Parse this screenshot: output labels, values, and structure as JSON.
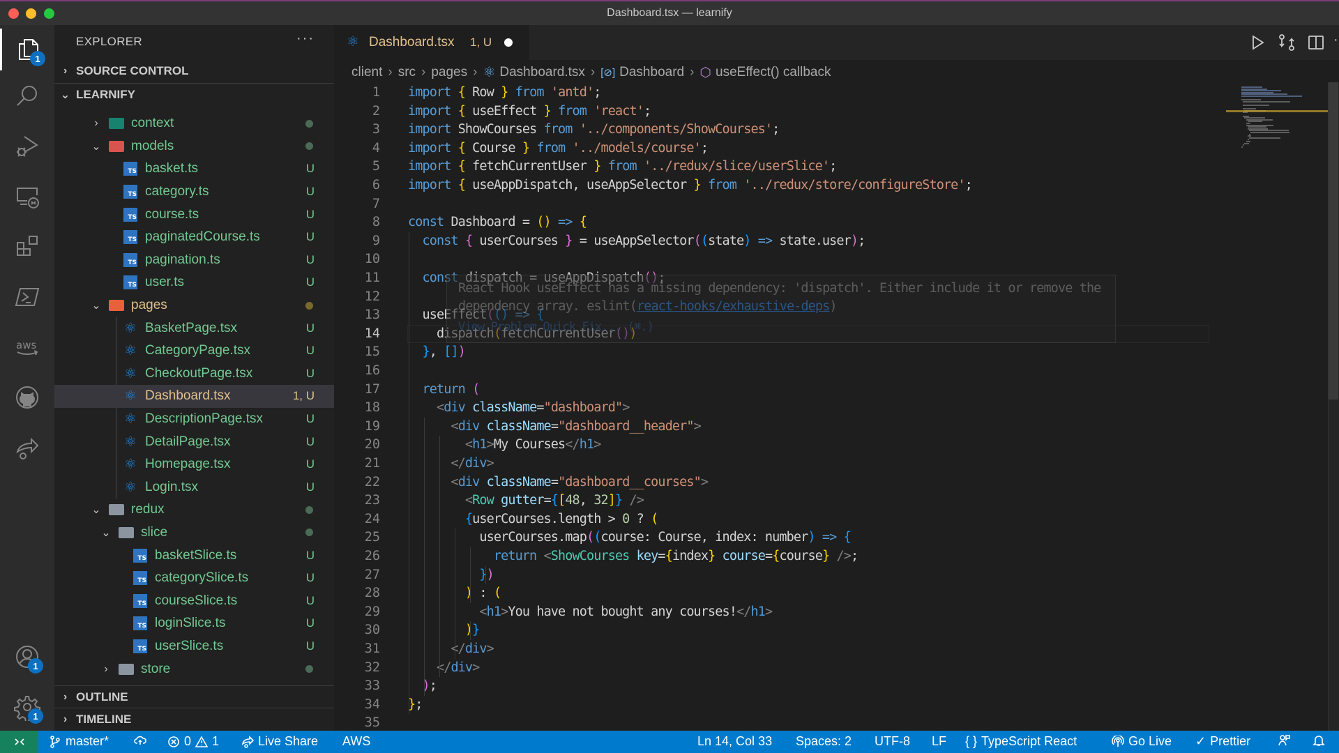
{
  "window": {
    "title": "Dashboard.tsx — learnify"
  },
  "activity_bar": {
    "items": [
      {
        "icon": "explorer-icon",
        "badge": "1",
        "active": true
      },
      {
        "icon": "search-icon"
      },
      {
        "icon": "run-debug-icon"
      },
      {
        "icon": "remote-explorer-icon"
      },
      {
        "icon": "extensions-icon"
      },
      {
        "icon": "powershell-icon"
      },
      {
        "icon": "aws-icon",
        "label": "aws"
      },
      {
        "icon": "github-icon"
      },
      {
        "icon": "live-share-icon"
      }
    ],
    "bottom": [
      {
        "icon": "accounts-icon",
        "badge": "1"
      },
      {
        "icon": "settings-gear-icon",
        "badge": "1"
      }
    ]
  },
  "sidebar": {
    "title": "EXPLORER",
    "more": "···",
    "sections": {
      "source_control": "SOURCE CONTROL",
      "project": "LEARNIFY",
      "outline": "OUTLINE",
      "timeline": "TIMELINE"
    },
    "tree": [
      {
        "name": "context",
        "type": "folder",
        "expanded": false,
        "depth": 2,
        "status": "dot"
      },
      {
        "name": "models",
        "type": "folder",
        "expanded": true,
        "depth": 2,
        "status": "dot"
      },
      {
        "name": "basket.ts",
        "type": "ts",
        "depth": 3,
        "status": "U"
      },
      {
        "name": "category.ts",
        "type": "ts",
        "depth": 3,
        "status": "U"
      },
      {
        "name": "course.ts",
        "type": "ts",
        "depth": 3,
        "status": "U"
      },
      {
        "name": "paginatedCourse.ts",
        "type": "ts",
        "depth": 3,
        "status": "U"
      },
      {
        "name": "pagination.ts",
        "type": "ts",
        "depth": 3,
        "status": "U"
      },
      {
        "name": "user.ts",
        "type": "ts",
        "depth": 3,
        "status": "U"
      },
      {
        "name": "pages",
        "type": "folder",
        "expanded": true,
        "depth": 2,
        "status": "dot-modified"
      },
      {
        "name": "BasketPage.tsx",
        "type": "tsx",
        "depth": 3,
        "status": "U"
      },
      {
        "name": "CategoryPage.tsx",
        "type": "tsx",
        "depth": 3,
        "status": "U"
      },
      {
        "name": "CheckoutPage.tsx",
        "type": "tsx",
        "depth": 3,
        "status": "U"
      },
      {
        "name": "Dashboard.tsx",
        "type": "tsx",
        "depth": 3,
        "status": "1, U",
        "selected": true
      },
      {
        "name": "DescriptionPage.tsx",
        "type": "tsx",
        "depth": 3,
        "status": "U"
      },
      {
        "name": "DetailPage.tsx",
        "type": "tsx",
        "depth": 3,
        "status": "U"
      },
      {
        "name": "Homepage.tsx",
        "type": "tsx",
        "depth": 3,
        "status": "U"
      },
      {
        "name": "Login.tsx",
        "type": "tsx",
        "depth": 3,
        "status": "U"
      },
      {
        "name": "redux",
        "type": "folder",
        "expanded": true,
        "depth": 2,
        "status": "dot"
      },
      {
        "name": "slice",
        "type": "folder",
        "expanded": true,
        "depth": 3,
        "status": "dot"
      },
      {
        "name": "basketSlice.ts",
        "type": "ts",
        "depth": 4,
        "status": "U"
      },
      {
        "name": "categorySlice.ts",
        "type": "ts",
        "depth": 4,
        "status": "U"
      },
      {
        "name": "courseSlice.ts",
        "type": "ts",
        "depth": 4,
        "status": "U"
      },
      {
        "name": "loginSlice.ts",
        "type": "ts",
        "depth": 4,
        "status": "U"
      },
      {
        "name": "userSlice.ts",
        "type": "ts",
        "depth": 4,
        "status": "U"
      },
      {
        "name": "store",
        "type": "folder",
        "expanded": false,
        "depth": 3,
        "status": "dot"
      }
    ]
  },
  "editor": {
    "tab": {
      "label": "Dashboard.tsx",
      "decoration": "1, U",
      "dirty": true
    },
    "actions": [
      "run-icon",
      "compare-changes-icon",
      "split-editor-icon",
      "more-actions-icon"
    ],
    "breadcrumb": [
      "client",
      "src",
      "pages",
      "Dashboard.tsx",
      "Dashboard",
      "useEffect() callback"
    ],
    "current_line": 14,
    "lines": [
      "import { Row } from 'antd';",
      "import { useEffect } from 'react';",
      "import ShowCourses from '../components/ShowCourses';",
      "import { Course } from '../models/course';",
      "import { fetchCurrentUser } from '../redux/slice/userSlice';",
      "import { useAppDispatch, useAppSelector } from '../redux/store/configureStore';",
      "",
      "const Dashboard = () => {",
      "  const { userCourses } = useAppSelector((state) => state.user);",
      "",
      "  const dispatch = useAppDispatch();",
      "",
      "  useEffect(() => {",
      "    dispatch(fetchCurrentUser())",
      "  }, [])",
      "",
      "  return (",
      "    <div className=\"dashboard\">",
      "      <div className=\"dashboard__header\">",
      "        <h1>My Courses</h1>",
      "      </div>",
      "      <div className=\"dashboard__courses\">",
      "        <Row gutter={[48, 32]} />",
      "        {userCourses.length > 0 ? (",
      "          userCourses.map((course: Course, index: number) => {",
      "            return <ShowCourses key={index} course={course} />;",
      "          })",
      "        ) : (",
      "          <h1>You have not bought any courses!</h1>",
      "        )}",
      "      </div>",
      "    </div>",
      "  );",
      "};",
      ""
    ],
    "hover": {
      "message": "React Hook useEffect has a missing dependency: 'dispatch'. Either include it or remove the dependency array.",
      "source_prefix": "eslint(",
      "rule": "react-hooks/exhaustive-deps",
      "source_suffix": ")",
      "actions": "View Problem   Quick Fix... (⌘.)"
    }
  },
  "status_bar": {
    "branch": "master*",
    "errors": "0",
    "warnings": "1",
    "live_share": "Live Share",
    "aws": "AWS",
    "position": "Ln 14, Col 33",
    "spaces": "Spaces: 2",
    "encoding": "UTF-8",
    "eol": "LF",
    "language": "TypeScript React",
    "go_live": "Go Live",
    "prettier": "Prettier"
  },
  "colors": {
    "accent": "#007acc",
    "remote": "#16825d",
    "untracked": "#73c991",
    "modified": "#e2c08d",
    "badge": "#0e70c0"
  }
}
